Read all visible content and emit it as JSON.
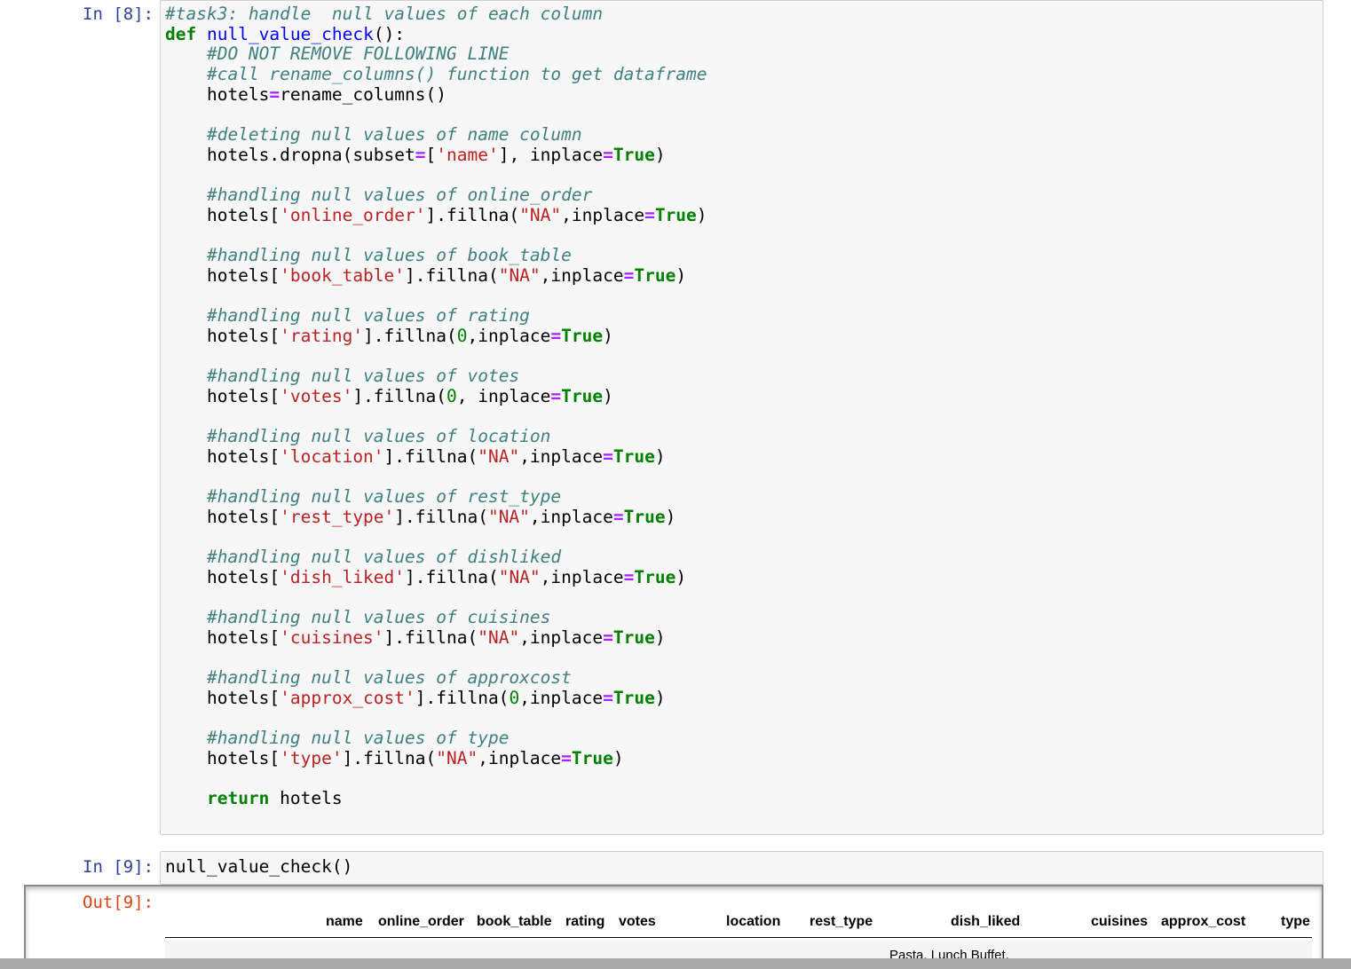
{
  "cell8": {
    "prompt": "In [8]:",
    "lines": [
      [
        {
          "t": "#task3: handle  null values of each column",
          "c": "comment"
        }
      ],
      [
        {
          "t": "def",
          "c": "kw"
        },
        {
          "t": " "
        },
        {
          "t": "null_value_check",
          "c": "fn"
        },
        {
          "t": "():"
        }
      ],
      [
        {
          "t": "    "
        },
        {
          "t": "#DO NOT REMOVE FOLLOWING LINE",
          "c": "comment"
        }
      ],
      [
        {
          "t": "    "
        },
        {
          "t": "#call rename_columns() function to get dataframe",
          "c": "comment"
        }
      ],
      [
        {
          "t": "    hotels"
        },
        {
          "t": "=",
          "c": "op"
        },
        {
          "t": "rename_columns()"
        }
      ],
      [
        {
          "t": ""
        }
      ],
      [
        {
          "t": "    "
        },
        {
          "t": "#deleting null values of name column",
          "c": "comment"
        }
      ],
      [
        {
          "t": "    hotels.dropna(subset"
        },
        {
          "t": "=",
          "c": "op"
        },
        {
          "t": "["
        },
        {
          "t": "'name'",
          "c": "str"
        },
        {
          "t": "], inplace"
        },
        {
          "t": "=",
          "c": "op"
        },
        {
          "t": "True",
          "c": "kw"
        },
        {
          "t": ")"
        }
      ],
      [
        {
          "t": ""
        }
      ],
      [
        {
          "t": "    "
        },
        {
          "t": "#handling null values of online_order",
          "c": "comment"
        }
      ],
      [
        {
          "t": "    hotels["
        },
        {
          "t": "'online_order'",
          "c": "str"
        },
        {
          "t": "].fillna("
        },
        {
          "t": "\"NA\"",
          "c": "str"
        },
        {
          "t": ",inplace"
        },
        {
          "t": "=",
          "c": "op"
        },
        {
          "t": "True",
          "c": "kw"
        },
        {
          "t": ")"
        }
      ],
      [
        {
          "t": ""
        }
      ],
      [
        {
          "t": "    "
        },
        {
          "t": "#handling null values of book_table",
          "c": "comment"
        }
      ],
      [
        {
          "t": "    hotels["
        },
        {
          "t": "'book_table'",
          "c": "str"
        },
        {
          "t": "].fillna("
        },
        {
          "t": "\"NA\"",
          "c": "str"
        },
        {
          "t": ",inplace"
        },
        {
          "t": "=",
          "c": "op"
        },
        {
          "t": "True",
          "c": "kw"
        },
        {
          "t": ")"
        }
      ],
      [
        {
          "t": ""
        }
      ],
      [
        {
          "t": "    "
        },
        {
          "t": "#handling null values of rating",
          "c": "comment"
        }
      ],
      [
        {
          "t": "    hotels["
        },
        {
          "t": "'rating'",
          "c": "str"
        },
        {
          "t": "].fillna("
        },
        {
          "t": "0",
          "c": "num"
        },
        {
          "t": ",inplace"
        },
        {
          "t": "=",
          "c": "op"
        },
        {
          "t": "True",
          "c": "kw"
        },
        {
          "t": ")"
        }
      ],
      [
        {
          "t": ""
        }
      ],
      [
        {
          "t": "    "
        },
        {
          "t": "#handling null values of votes",
          "c": "comment"
        }
      ],
      [
        {
          "t": "    hotels["
        },
        {
          "t": "'votes'",
          "c": "str"
        },
        {
          "t": "].fillna("
        },
        {
          "t": "0",
          "c": "num"
        },
        {
          "t": ", inplace"
        },
        {
          "t": "=",
          "c": "op"
        },
        {
          "t": "True",
          "c": "kw"
        },
        {
          "t": ")"
        }
      ],
      [
        {
          "t": ""
        }
      ],
      [
        {
          "t": "    "
        },
        {
          "t": "#handling null values of location",
          "c": "comment"
        }
      ],
      [
        {
          "t": "    hotels["
        },
        {
          "t": "'location'",
          "c": "str"
        },
        {
          "t": "].fillna("
        },
        {
          "t": "\"NA\"",
          "c": "str"
        },
        {
          "t": ",inplace"
        },
        {
          "t": "=",
          "c": "op"
        },
        {
          "t": "True",
          "c": "kw"
        },
        {
          "t": ")"
        }
      ],
      [
        {
          "t": ""
        }
      ],
      [
        {
          "t": "    "
        },
        {
          "t": "#handling null values of rest_type",
          "c": "comment"
        }
      ],
      [
        {
          "t": "    hotels["
        },
        {
          "t": "'rest_type'",
          "c": "str"
        },
        {
          "t": "].fillna("
        },
        {
          "t": "\"NA\"",
          "c": "str"
        },
        {
          "t": ",inplace"
        },
        {
          "t": "=",
          "c": "op"
        },
        {
          "t": "True",
          "c": "kw"
        },
        {
          "t": ")"
        }
      ],
      [
        {
          "t": ""
        }
      ],
      [
        {
          "t": "    "
        },
        {
          "t": "#handling null values of dishliked",
          "c": "comment"
        }
      ],
      [
        {
          "t": "    hotels["
        },
        {
          "t": "'dish_liked'",
          "c": "str"
        },
        {
          "t": "].fillna("
        },
        {
          "t": "\"NA\"",
          "c": "str"
        },
        {
          "t": ",inplace"
        },
        {
          "t": "=",
          "c": "op"
        },
        {
          "t": "True",
          "c": "kw"
        },
        {
          "t": ")"
        }
      ],
      [
        {
          "t": ""
        }
      ],
      [
        {
          "t": "    "
        },
        {
          "t": "#handling null values of cuisines",
          "c": "comment"
        }
      ],
      [
        {
          "t": "    hotels["
        },
        {
          "t": "'cuisines'",
          "c": "str"
        },
        {
          "t": "].fillna("
        },
        {
          "t": "\"NA\"",
          "c": "str"
        },
        {
          "t": ",inplace"
        },
        {
          "t": "=",
          "c": "op"
        },
        {
          "t": "True",
          "c": "kw"
        },
        {
          "t": ")"
        }
      ],
      [
        {
          "t": ""
        }
      ],
      [
        {
          "t": "    "
        },
        {
          "t": "#handling null values of approxcost",
          "c": "comment"
        }
      ],
      [
        {
          "t": "    hotels["
        },
        {
          "t": "'approx_cost'",
          "c": "str"
        },
        {
          "t": "].fillna("
        },
        {
          "t": "0",
          "c": "num"
        },
        {
          "t": ",inplace"
        },
        {
          "t": "=",
          "c": "op"
        },
        {
          "t": "True",
          "c": "kw"
        },
        {
          "t": ")"
        }
      ],
      [
        {
          "t": ""
        }
      ],
      [
        {
          "t": "    "
        },
        {
          "t": "#handling null values of type",
          "c": "comment"
        }
      ],
      [
        {
          "t": "    hotels["
        },
        {
          "t": "'type'",
          "c": "str"
        },
        {
          "t": "].fillna("
        },
        {
          "t": "\"NA\"",
          "c": "str"
        },
        {
          "t": ",inplace"
        },
        {
          "t": "=",
          "c": "op"
        },
        {
          "t": "True",
          "c": "kw"
        },
        {
          "t": ")"
        }
      ],
      [
        {
          "t": ""
        }
      ],
      [
        {
          "t": "    "
        },
        {
          "t": "return",
          "c": "kw"
        },
        {
          "t": " hotels"
        }
      ]
    ]
  },
  "cell9": {
    "prompt": "In [9]:",
    "code": "null_value_check()",
    "out_prompt": "Out[9]:"
  },
  "output_table": {
    "columns": [
      "name",
      "online_order",
      "book_table",
      "rating",
      "votes",
      "location",
      "rest_type",
      "dish_liked",
      "cuisines",
      "approx_cost",
      "type"
    ],
    "partial_row_text": "Pasta, Lunch Buffet,"
  },
  "colors": {
    "prompt_in": "#303f9f",
    "prompt_out": "#d84315",
    "comment": "#408080",
    "keyword": "#008000",
    "string": "#ba2121",
    "operator": "#aa22ff",
    "function": "#0000ff"
  }
}
